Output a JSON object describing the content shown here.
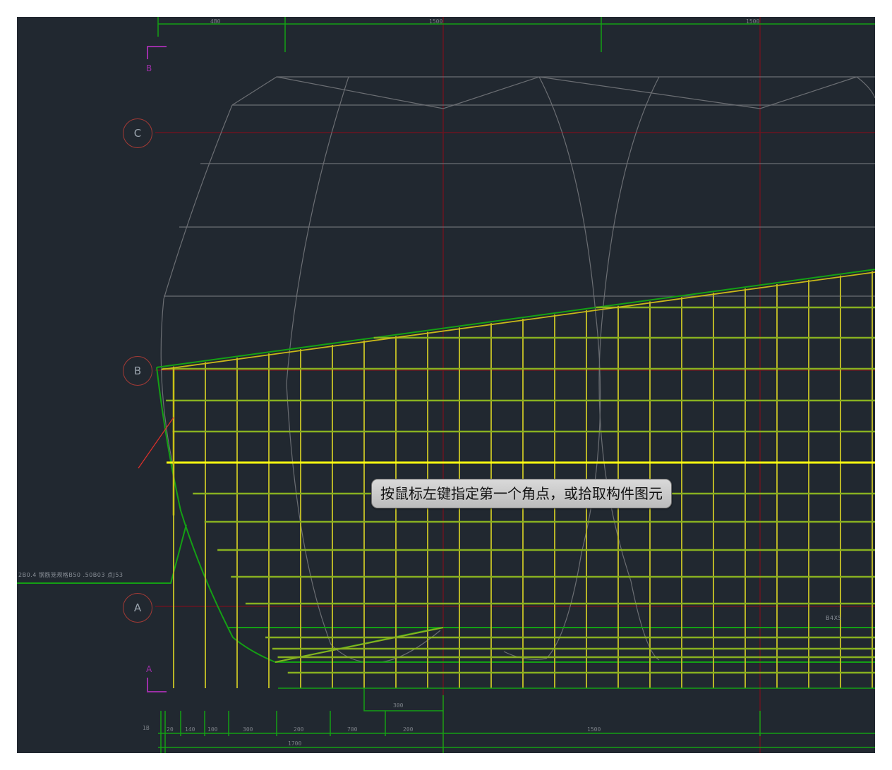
{
  "tooltip": {
    "text": "按鼠标左键指定第一个角点，或拾取构件图元"
  },
  "axes": {
    "C": "C",
    "B": "B",
    "A": "A"
  },
  "section_marks": {
    "top": "B",
    "bottom": "A"
  },
  "dimensions": {
    "top": [
      "4B0",
      "1500",
      "1500"
    ],
    "bottom_inner": "300",
    "bottom_row": [
      "1B",
      "20",
      "140",
      "100",
      "300",
      "200",
      "700",
      "200",
      "1500"
    ],
    "bottom_total": "1700"
  },
  "labels": {
    "left_note": "2B0.4  钢筋笼规格B50      .50B03   点J53",
    "right_note": "B4X5"
  },
  "colors": {
    "background": "#212830",
    "grid_yellow": "#b8b426",
    "highlight_yellow": "#ffff10",
    "outline_green": "#14a014",
    "axis_red": "#6a1420",
    "bubble_red": "#a33a35",
    "tunnel_gray": "#6b6e73",
    "section_purple": "#9b2fa6",
    "arrow_red": "#e0302a"
  }
}
